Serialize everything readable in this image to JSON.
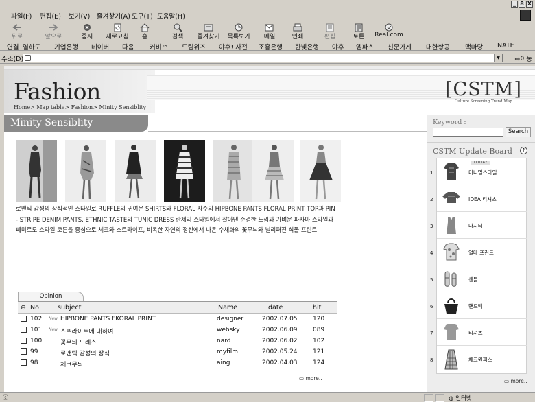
{
  "menu": [
    "파일(F)",
    "편집(E)",
    "보기(V)",
    "즐겨찾기(A)",
    "도구(T)",
    "도움말(H)"
  ],
  "window_buttons": [
    "_",
    "8",
    "X"
  ],
  "toolbar": [
    "뒤로",
    "앞으로",
    "중지",
    "새로고침",
    "홈",
    "검색",
    "즐겨찾기",
    "목록보기",
    "메일",
    "인쇄",
    "편집",
    "토론",
    "Real.com"
  ],
  "links_label": "연결",
  "links": [
    "열하도",
    "기업은행",
    "네이버",
    "다음",
    "커비™",
    "드림위즈",
    "야후! 사전",
    "조흥은행",
    "한빛은행",
    "야후",
    "엠파스",
    "신문가게",
    "대한항공",
    "맥마당",
    "NATE"
  ],
  "address": {
    "label": "주소(D)",
    "go": "이동"
  },
  "page": {
    "title": "Fashion",
    "breadcrumb": "Home> Map table> Fashion> Minity Sensiblity",
    "logo": "CSTM",
    "logo_sub": "Culture Screening Trend Map",
    "section_title": "Minity Sensiblity",
    "description": "로맨틱 감성의 장식적인 스타일로 RUFFLE의 귀여운 SHIRTS와 FLORAL 자수의 HIPBONE PANTS FLORAL PRINT TOP과 PIN - STRIPE DENIM PANTS, ETHNIC TASTE의 TUNIC DRESS 란제리 스타일에서 찰아낸 순결한 느낌과 가벼운 파자마 스타일과 페미르도 스타일 코튼을 중심으로 체크와 스트라이프, 비옥한 자연의 정신에서 나온 수채화의 꽃무늬와 널리퍼진 식물 프린트"
  },
  "opinion": {
    "tab": "Opinion",
    "headers": {
      "no": "No",
      "subject": "subject",
      "name": "Name",
      "date": "date",
      "hit": "hit"
    },
    "rows": [
      {
        "no": "102",
        "new": "New",
        "subject": "HIPBONE PANTS FKORAL PRINT",
        "name": "designer",
        "date": "2002.07.05",
        "hit": "120"
      },
      {
        "no": "101",
        "new": "New",
        "subject": "스프라이트에 대하여",
        "name": "websky",
        "date": "2002.06.09",
        "hit": "089"
      },
      {
        "no": "100",
        "new": "",
        "subject": "꽃무늬 드레스",
        "name": "nard",
        "date": "2002.06.02",
        "hit": "102"
      },
      {
        "no": "99",
        "new": "",
        "subject": "로맨틱 감성의 장식",
        "name": "myfilm",
        "date": "2002.05.24",
        "hit": "121"
      },
      {
        "no": "98",
        "new": "",
        "subject": "체크무늬",
        "name": "aing",
        "date": "2002.04.03",
        "hit": "124"
      }
    ],
    "more": "more.."
  },
  "sidebar": {
    "keyword_label": "Keyword :",
    "search_button": "Search",
    "board_title": "CSTM Update Board",
    "today_badge": "TODAY",
    "items": [
      {
        "num": "1",
        "label": "미니멀스타일"
      },
      {
        "num": "2",
        "label": "IDEA 티셔츠"
      },
      {
        "num": "3",
        "label": "나시티"
      },
      {
        "num": "4",
        "label": "열대 프린트"
      },
      {
        "num": "5",
        "label": "샌들"
      },
      {
        "num": "6",
        "label": "핸드백"
      },
      {
        "num": "7",
        "label": "티셔츠"
      },
      {
        "num": "8",
        "label": "체크원피스"
      }
    ],
    "more": "more.."
  },
  "status": {
    "zone": "인터넷"
  }
}
